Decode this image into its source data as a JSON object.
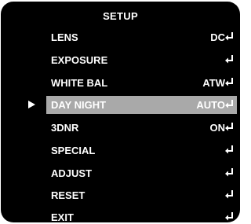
{
  "osd": {
    "title": "SETUP",
    "items": [
      {
        "label": "LENS",
        "value": "DC",
        "selected": false
      },
      {
        "label": "EXPOSURE",
        "value": "",
        "selected": false
      },
      {
        "label": "WHITE BAL",
        "value": "ATW",
        "selected": false
      },
      {
        "label": "DAY NIGHT",
        "value": "AUTO",
        "selected": true
      },
      {
        "label": "3DNR",
        "value": "ON",
        "selected": false
      },
      {
        "label": "SPECIAL",
        "value": "",
        "selected": false
      },
      {
        "label": "ADJUST",
        "value": "",
        "selected": false
      },
      {
        "label": "RESET",
        "value": "",
        "selected": false
      },
      {
        "label": "EXIT",
        "value": "",
        "selected": false
      }
    ],
    "enter_icon": "enter-return-icon",
    "cursor_icon": "triangle-right-icon",
    "colors": {
      "background": "#000000",
      "text": "#ffffff",
      "selection": "#a9a9a9"
    }
  }
}
